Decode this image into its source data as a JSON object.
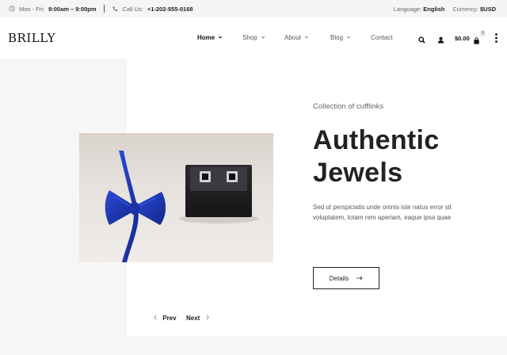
{
  "topbar": {
    "hours_label": "Mon - Fri:",
    "hours_value": "9:00am – 9:00pm",
    "call_label": "Call Us:",
    "call_value": "+1-202-555-0168",
    "language_label": "Language:",
    "language_value": "English",
    "currency_label": "Currency:",
    "currency_value": "$USD"
  },
  "header": {
    "logo": "BRILLY",
    "nav": [
      {
        "label": "Home",
        "has_dropdown": true,
        "active": true
      },
      {
        "label": "Shop",
        "has_dropdown": true
      },
      {
        "label": "About",
        "has_dropdown": true
      },
      {
        "label": "Blog",
        "has_dropdown": true
      },
      {
        "label": "Contact",
        "has_dropdown": false
      }
    ],
    "cart_amount": "$0.00",
    "cart_count": "0",
    "icons": [
      "search-icon",
      "user-icon",
      "shopping-bag-icon",
      "more-vertical-icon"
    ]
  },
  "hero": {
    "eyebrow": "Collection of cufflinks",
    "title_line1": "Authentic",
    "title_line2": "Jewels",
    "description": "Sed ut perspiciatis unde omnis iste natus error sit voluptatem, totam rem aperiam, eaque ipsa quae",
    "button_label": "Details",
    "prev_label": "Prev",
    "next_label": "Next"
  },
  "colors": {
    "topbar_bg": "#f5f5f5",
    "panel_bg": "#f6f6f6",
    "accent_blue": "#1f3fbf",
    "text_dark": "#222222"
  }
}
